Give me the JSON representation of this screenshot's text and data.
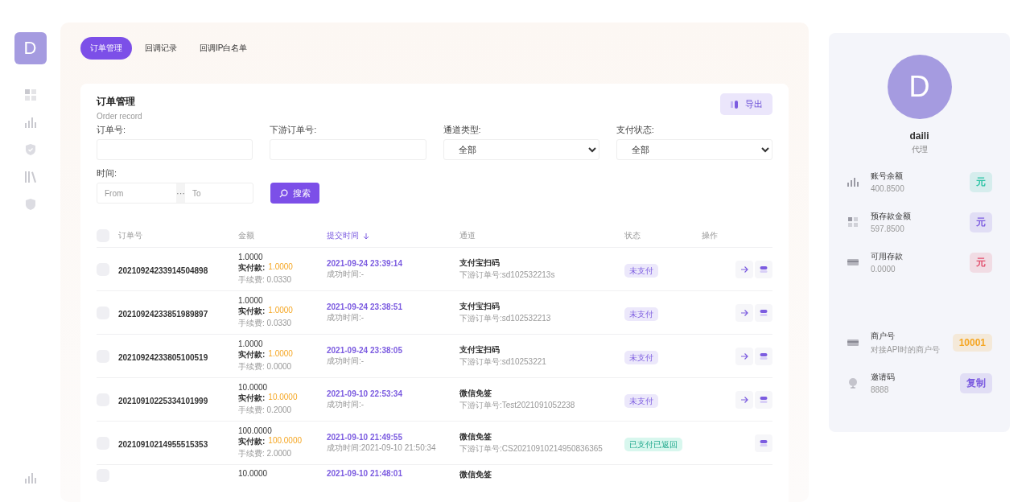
{
  "sidebar": {
    "logo": "D"
  },
  "tabs": [
    {
      "label": "订单管理",
      "selected": true
    },
    {
      "label": "回调记录",
      "selected": false
    },
    {
      "label": "回调IP白名单",
      "selected": false
    }
  ],
  "card": {
    "title": "订单管理",
    "subtitle": "Order record",
    "export_button": "导出"
  },
  "filters": [
    {
      "kind": "input",
      "label": "订单号:"
    },
    {
      "kind": "input",
      "label": "下游订单号:"
    },
    {
      "kind": "select",
      "label": "通道类型:",
      "value": "全部"
    },
    {
      "kind": "select",
      "label": "支付状态:",
      "value": "全部"
    }
  ],
  "time_filter": {
    "label": "时间:",
    "from_placeholder": "From",
    "separator": "···",
    "to_placeholder": "To"
  },
  "search_button": "搜索",
  "table": {
    "header_checked": false,
    "columns": [
      {
        "label": "订单号",
        "sorted": false
      },
      {
        "label": "金额",
        "sorted": false
      },
      {
        "label": "提交时间",
        "sorted": true
      },
      {
        "label": "通道",
        "sorted": false
      },
      {
        "label": "状态",
        "sorted": false
      },
      {
        "label": "操作",
        "sorted": false
      }
    ],
    "rows": [
      {
        "checked": false,
        "order_no": "20210924233914504898",
        "amount": "1.0000",
        "paid_label": "实付款:",
        "paid": "1.0000",
        "fee": "手续费: 0.0330",
        "submit_time": "2021-09-24 23:39:14",
        "success_time": "成功时间:-",
        "channel": "支付宝扫码",
        "downstream_no": "下游订单号:sd102532213s",
        "status": {
          "label": "未支付",
          "kind": "unpaid"
        },
        "detail_button": true
      },
      {
        "checked": false,
        "order_no": "20210924233851989897",
        "amount": "1.0000",
        "paid_label": "实付款:",
        "paid": "1.0000",
        "fee": "手续费: 0.0330",
        "submit_time": "2021-09-24 23:38:51",
        "success_time": "成功时间:-",
        "channel": "支付宝扫码",
        "downstream_no": "下游订单号:sd102532213",
        "status": {
          "label": "未支付",
          "kind": "unpaid"
        },
        "detail_button": true
      },
      {
        "checked": false,
        "order_no": "20210924233805100519",
        "amount": "1.0000",
        "paid_label": "实付款:",
        "paid": "1.0000",
        "fee": "手续费: 0.0000",
        "submit_time": "2021-09-24 23:38:05",
        "success_time": "成功时间:-",
        "channel": "支付宝扫码",
        "downstream_no": "下游订单号:sd10253221",
        "status": {
          "label": "未支付",
          "kind": "unpaid"
        },
        "detail_button": true
      },
      {
        "checked": false,
        "order_no": "20210910225334101999",
        "amount": "10.0000",
        "paid_label": "实付款:",
        "paid": "10.0000",
        "fee": "手续费: 0.2000",
        "submit_time": "2021-09-10 22:53:34",
        "success_time": "成功时间:-",
        "channel": "微信免签",
        "downstream_no": "下游订单号:Test2021091052238",
        "status": {
          "label": "未支付",
          "kind": "unpaid"
        },
        "detail_button": true
      },
      {
        "checked": false,
        "order_no": "20210910214955515353",
        "amount": "100.0000",
        "paid_label": "实付款:",
        "paid": "100.0000",
        "fee": "手续费: 2.0000",
        "submit_time": "2021-09-10 21:49:55",
        "success_time": "成功时间:2021-09-10 21:50:34",
        "channel": "微信免签",
        "downstream_no": "下游订单号:CS20210910214950836365",
        "status": {
          "label": "已支付已返回",
          "kind": "paid"
        },
        "detail_button": false
      },
      {
        "checked": false,
        "amount": "10.0000",
        "submit_time": "2021-09-10 21:48:01",
        "channel": "微信免签"
      }
    ]
  },
  "profile": {
    "avatar": "D",
    "name": "daili",
    "role": "代理",
    "stats": [
      {
        "label": "账号余额",
        "value": "400.8500",
        "badge": "元",
        "color": "#2ec4a6"
      },
      {
        "label": "预存款金额",
        "value": "597.8500",
        "badge": "元",
        "color": "#7c5ce0"
      },
      {
        "label": "可用存款",
        "value": "0.0000",
        "badge": "元",
        "color": "#e2506e"
      },
      {
        "label": "商户号",
        "value": "对接API时的商户号",
        "badge": "10001",
        "color": "#f5a623"
      },
      {
        "label": "邀请码",
        "value": "8888",
        "badge": "复制",
        "color": "#7c5ce0"
      }
    ]
  }
}
